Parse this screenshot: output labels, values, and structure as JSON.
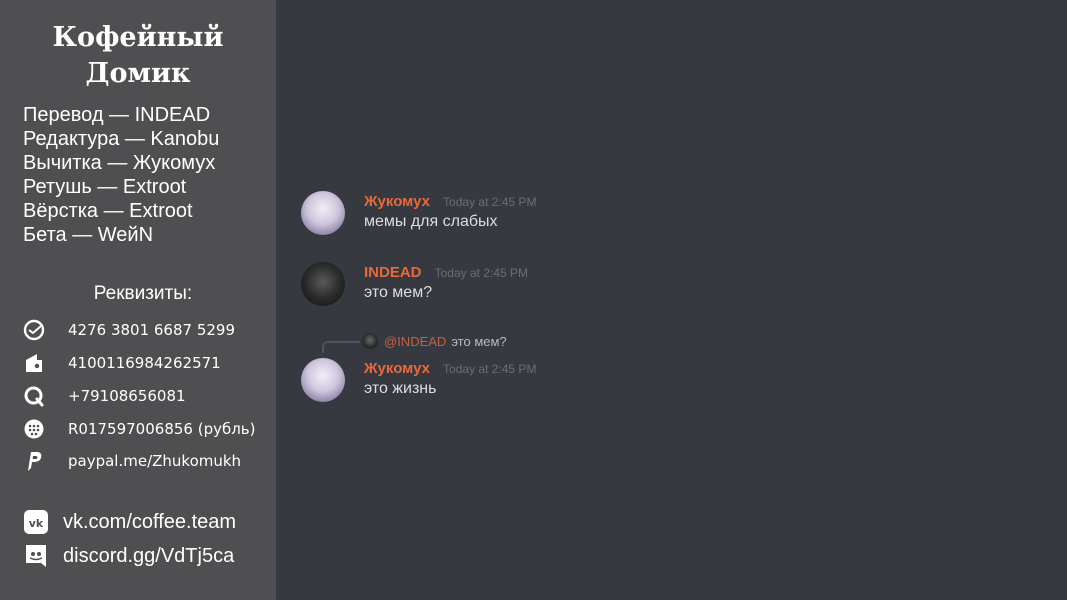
{
  "sidebar": {
    "title_line1": "Кофейный",
    "title_line2": "Домик",
    "credits": [
      "Перевод — INDEAD",
      "Редактура — Kanobu",
      "Вычитка — Жукомух",
      "Ретушь — Extroot",
      "Вёрстка — Extroot",
      "Бета — WeйN"
    ],
    "requisites_title": "Реквизиты:",
    "payments": [
      {
        "icon": "sberbank-icon",
        "text": "4276 3801 6687 5299"
      },
      {
        "icon": "yandex-money-icon",
        "text": "4100116984262571"
      },
      {
        "icon": "qiwi-icon",
        "text": "+79108656081"
      },
      {
        "icon": "webmoney-icon",
        "text": "R017597006856 (рубль)"
      },
      {
        "icon": "paypal-icon",
        "text": "paypal.me/Zhukomukh"
      }
    ],
    "socials": [
      {
        "icon": "vk-icon",
        "text": "vk.com/coffee.team"
      },
      {
        "icon": "discord-icon",
        "text": "discord.gg/VdTj5ca"
      }
    ]
  },
  "chat": {
    "messages": [
      {
        "author": "Жукомух",
        "timestamp": "Today at 2:45 PM",
        "text": "мемы для слабых"
      },
      {
        "author": "INDEAD",
        "timestamp": "Today at 2:45 PM",
        "text": "это мем?"
      },
      {
        "author": "Жукомух",
        "timestamp": "Today at 2:45 PM",
        "text": "это жизнь"
      }
    ],
    "reply": {
      "mention": "@INDEAD",
      "text": "это мем?"
    }
  },
  "colors": {
    "sidebar_bg": "#4f4f51",
    "chat_bg": "#36393f",
    "author": "#e8693c",
    "message_text": "#dcddde",
    "timestamp": "#6b6e74"
  }
}
